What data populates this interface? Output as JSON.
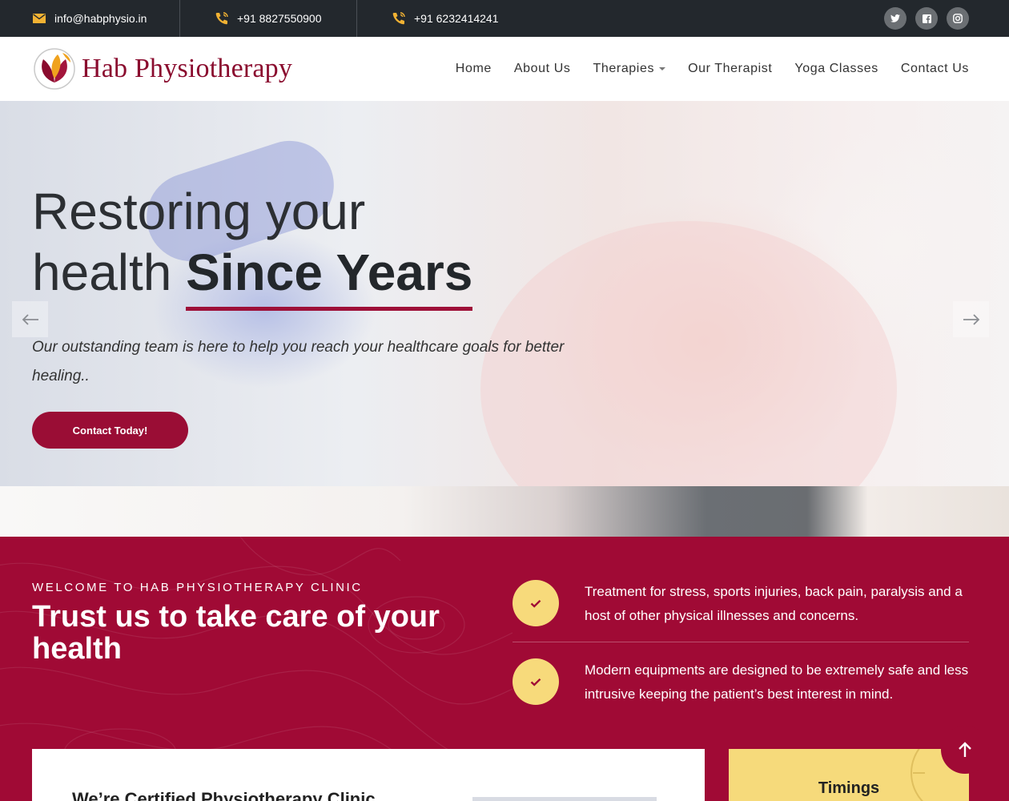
{
  "topbar": {
    "email": "info@habphysio.in",
    "phone1": "+91 8827550900",
    "phone2": "+91 6232414241",
    "socials": [
      "twitter-icon",
      "facebook-icon",
      "instagram-icon"
    ]
  },
  "nav": {
    "logo_text": "Hab Physiotherapy",
    "items": [
      {
        "label": "Home"
      },
      {
        "label": "About Us"
      },
      {
        "label": "Therapies"
      },
      {
        "label": "Our Therapist"
      },
      {
        "label": "Yoga Classes"
      },
      {
        "label": "Contact Us"
      }
    ]
  },
  "hero": {
    "title_line1": "Restoring your",
    "title_line2_plain": "health ",
    "title_line2_strong": "Since Years",
    "subtitle": "Our outstanding team is here to help you reach your healthcare goals for better healing..",
    "button": "Contact Today!"
  },
  "welcome": {
    "eyebrow": "WELCOME TO HAB PHYSIOTHERAPY CLINIC",
    "title": "Trust us to take care of your health",
    "features": [
      {
        "text": "Treatment for stress, sports injuries, back pain, paralysis and a host of other physical illnesses and concerns."
      },
      {
        "text": "Modern equipments are designed to be extremely safe and less intrusive keeping the patient’s best interest in mind."
      }
    ]
  },
  "cards": {
    "certified_heading": "We’re Certified Physiotherapy Clinic",
    "timings_heading": "Timings"
  },
  "colors": {
    "brand": "#a00a35",
    "accent_yellow": "#f7da7b",
    "topbar": "#23282d"
  }
}
